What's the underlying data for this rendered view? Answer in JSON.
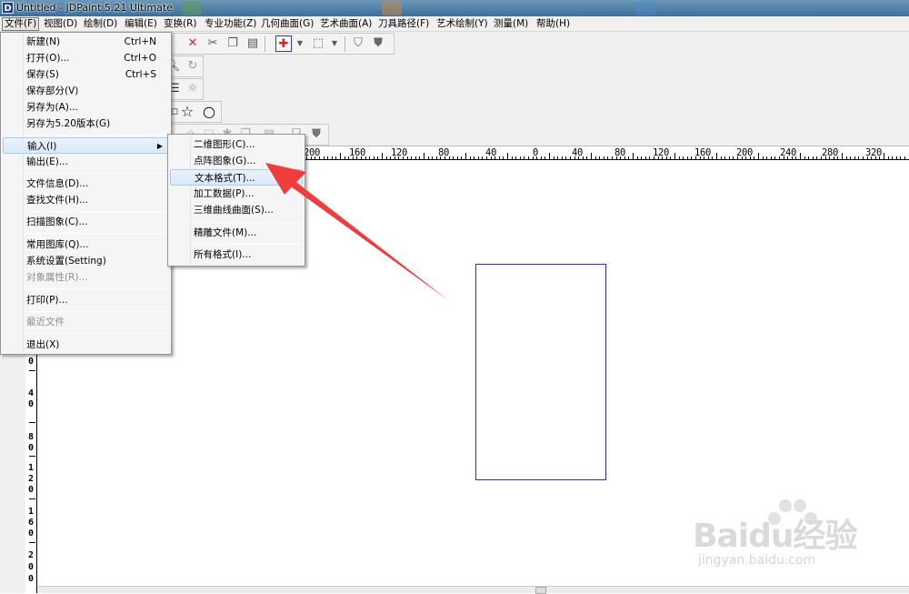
{
  "window": {
    "title": "Untitled - JDPaint 5.21 Ultimate",
    "icon": "jdpaint-app-icon"
  },
  "menubar": [
    {
      "label": "文件(F)"
    },
    {
      "label": "视图(D)"
    },
    {
      "label": "绘制(D)"
    },
    {
      "label": "编辑(E)"
    },
    {
      "label": "变换(R)"
    },
    {
      "label": "专业功能(Z)"
    },
    {
      "label": "几何曲面(G)"
    },
    {
      "label": "艺术曲面(A)"
    },
    {
      "label": "刀具路径(F)"
    },
    {
      "label": "艺术绘制(Y)"
    },
    {
      "label": "测量(M)"
    },
    {
      "label": "帮助(H)"
    }
  ],
  "file_menu": {
    "items": [
      {
        "label": "新建(N)",
        "shortcut": "Ctrl+N"
      },
      {
        "label": "打开(O)...",
        "shortcut": "Ctrl+O"
      },
      {
        "label": "保存(S)",
        "shortcut": "Ctrl+S"
      },
      {
        "label": "保存部分(V)",
        "shortcut": ""
      },
      {
        "label": "另存为(A)...",
        "shortcut": ""
      },
      {
        "label": "另存为5.20版本(G)",
        "shortcut": ""
      },
      {
        "label": "输入(I)",
        "shortcut": ""
      },
      {
        "label": "输出(E)...",
        "shortcut": ""
      },
      {
        "label": "文件信息(D)...",
        "shortcut": ""
      },
      {
        "label": "查找文件(H)...",
        "shortcut": ""
      },
      {
        "label": "扫描图象(C)...",
        "shortcut": ""
      },
      {
        "label": "常用图库(Q)...",
        "shortcut": ""
      },
      {
        "label": "系统设置(Setting)",
        "shortcut": ""
      },
      {
        "label": "对象属性(R)...",
        "shortcut": ""
      },
      {
        "label": "打印(P)...",
        "shortcut": ""
      },
      {
        "label": "最近文件",
        "shortcut": ""
      },
      {
        "label": "退出(X)",
        "shortcut": ""
      }
    ]
  },
  "input_submenu": {
    "items": [
      {
        "label": "二维图形(C)..."
      },
      {
        "label": "点阵图象(G)..."
      },
      {
        "label": "文本格式(T)..."
      },
      {
        "label": "加工数据(P)..."
      },
      {
        "label": "三维曲线曲面(S)..."
      },
      {
        "label": "精雕文件(M)..."
      },
      {
        "label": "所有格式(I)..."
      }
    ]
  },
  "ruler": {
    "horizontal": [
      "200",
      "160",
      "120",
      "80",
      "40",
      "0",
      "40",
      "80",
      "120",
      "160",
      "200",
      "240",
      "280",
      "320"
    ],
    "vertical": [
      "0",
      "4",
      "0",
      "8",
      "0",
      "1",
      "2",
      "0",
      "1",
      "6",
      "0",
      "2",
      "0",
      "0"
    ]
  },
  "watermark": {
    "brand": "Baidu经验",
    "url": "jingyan.baidu.com"
  },
  "colors": {
    "shape_stroke": "#2b2bd6",
    "annotation_arrow": "#f03c3c",
    "highlight": "#d9e8fa"
  }
}
